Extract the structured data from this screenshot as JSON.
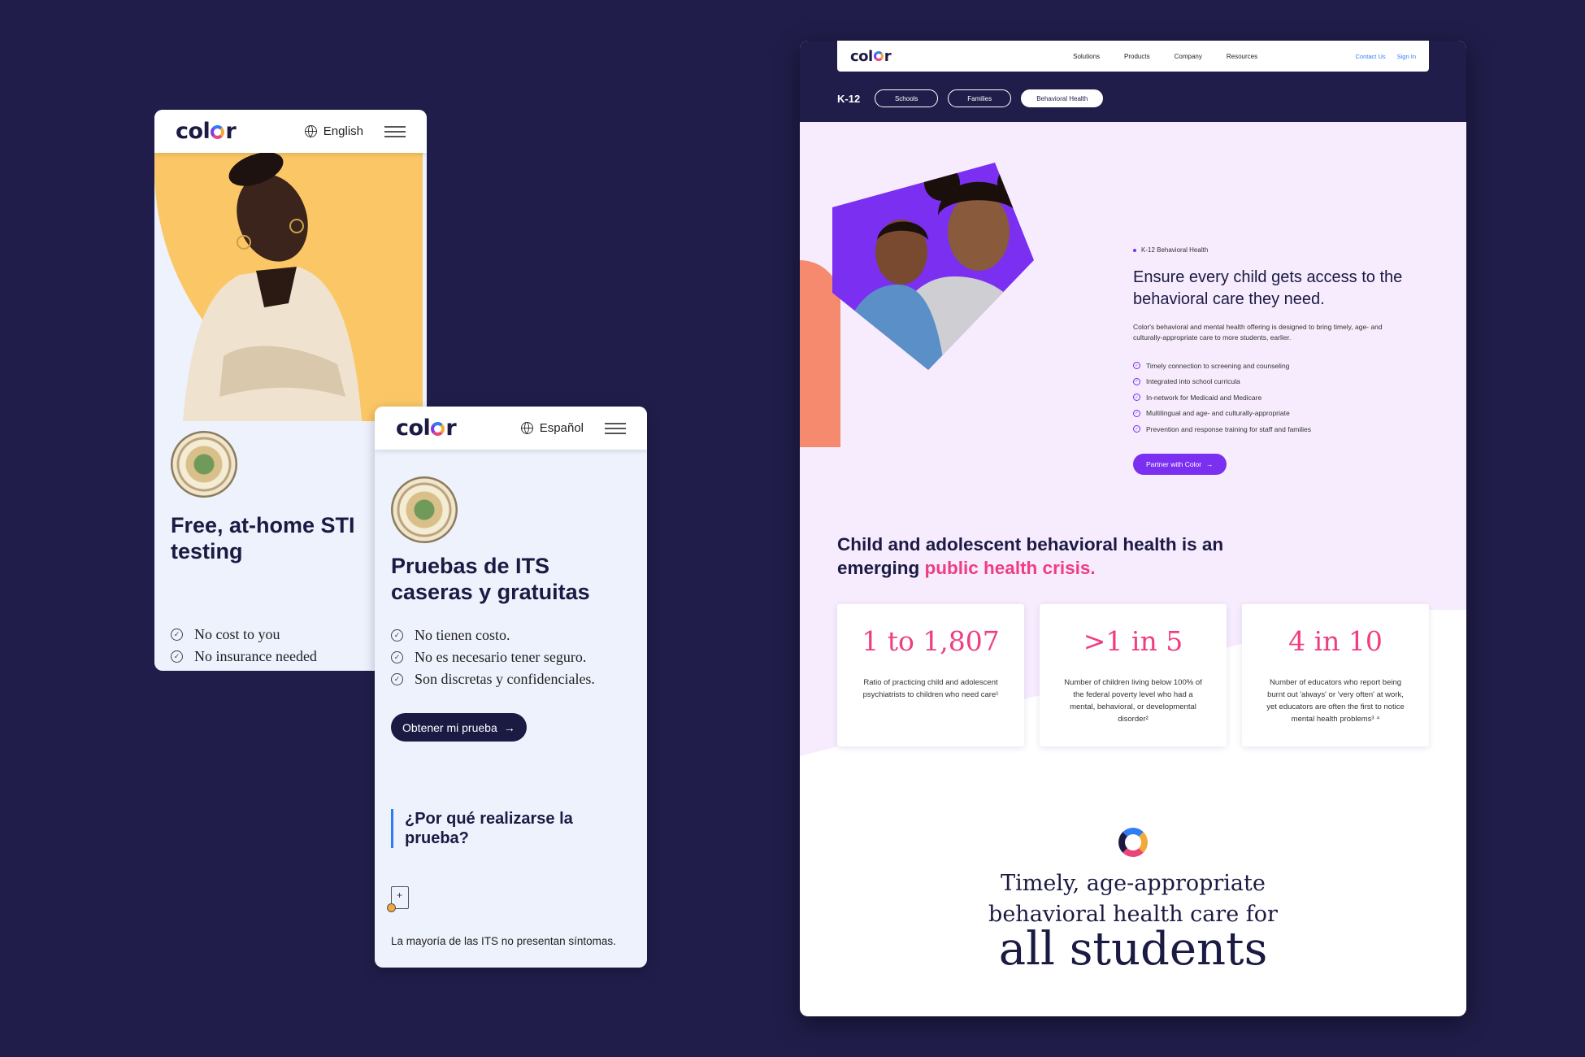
{
  "phone_en": {
    "logo": "color",
    "language": "English",
    "title": "Free, at-home STI testing",
    "checklist": [
      "No cost to you",
      "No insurance needed"
    ]
  },
  "phone_es": {
    "logo": "color",
    "language": "Español",
    "title": "Pruebas de ITS caseras y gratuitas",
    "checklist": [
      "No tienen costo.",
      "No es necesario tener seguro.",
      "Son discretas y confidenciales."
    ],
    "cta": "Obtener mi prueba",
    "why_heading": "¿Por qué realizarse la prueba?",
    "note": "La mayoría de las ITS no presentan síntomas."
  },
  "desktop": {
    "logo": "color",
    "nav": [
      "Solutions",
      "Products",
      "Company",
      "Resources"
    ],
    "nav_right": [
      "Contact Us",
      "Sign In"
    ],
    "section_label": "K-12",
    "pills": [
      {
        "label": "Schools",
        "active": false
      },
      {
        "label": "Families",
        "active": false
      },
      {
        "label": "Behavioral Health",
        "active": true
      }
    ],
    "eyebrow": "K-12 Behavioral Health",
    "headline": "Ensure every child gets access to the behavioral care they need.",
    "intro": "Color's behavioral and mental health offering is designed to bring timely, age- and culturally-appropriate care to more students, earlier.",
    "features": [
      "Timely connection to screening and counseling",
      "Integrated into school curricula",
      "In-network for Medicaid and Medicare",
      "Multilingual and age- and culturally-appropriate",
      "Prevention and response training for staff and families"
    ],
    "cta": "Partner with Color",
    "crisis_lead": "Child and adolescent behavioral health is an emerging",
    "crisis_highlight": "public health crisis.",
    "stats": [
      {
        "value": "1 to 1,807",
        "desc": "Ratio of practicing child and adolescent psychiatrists to children who need care¹"
      },
      {
        "value": ">1 in 5",
        "desc": "Number of children living below 100% of the federal poverty level who had a mental, behavioral, or developmental disorder²"
      },
      {
        "value": "4 in 10",
        "desc": "Number of educators who report being burnt out 'always' or 'very often' at work, yet educators are often the first to notice mental health problems³ ⁴"
      }
    ],
    "tagline": "Timely, age-appropriate behavioral health care for",
    "tagline_big": "all students"
  },
  "colors": {
    "navy": "#201d4a",
    "ink": "#1b1a43",
    "purple": "#7b2ff0",
    "pink": "#ef3d82",
    "yellow": "#fbc766",
    "coral": "#f68a6f",
    "blue": "#2f7cf6"
  },
  "icons": [
    "globe-icon",
    "hamburger-icon",
    "check-circle-icon",
    "arrow-right-icon",
    "document-icon",
    "color-ring-icon",
    "county-seal"
  ]
}
